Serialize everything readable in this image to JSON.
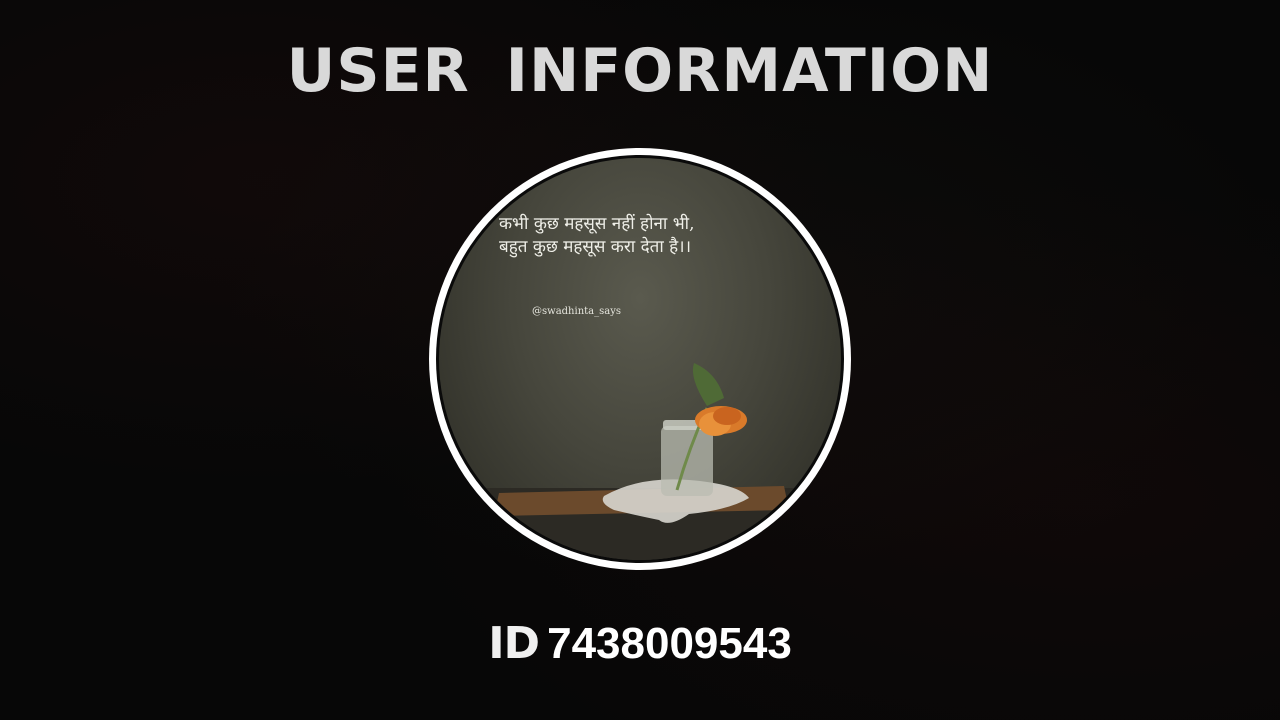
{
  "header": {
    "title": "USER  INFORMATION"
  },
  "profile": {
    "avatar": {
      "quote": "कभी कुछ महसूस नहीं होना भी,\nबहुत कुछ महसूस करा देता है।।",
      "handle": "@swadhinta_says"
    },
    "id_label": "ID",
    "id_value": "7438009543"
  },
  "colors": {
    "background": "#070707",
    "title": "#d9d9d9",
    "ring": "#ffffff",
    "id_text": "#ffffff"
  }
}
